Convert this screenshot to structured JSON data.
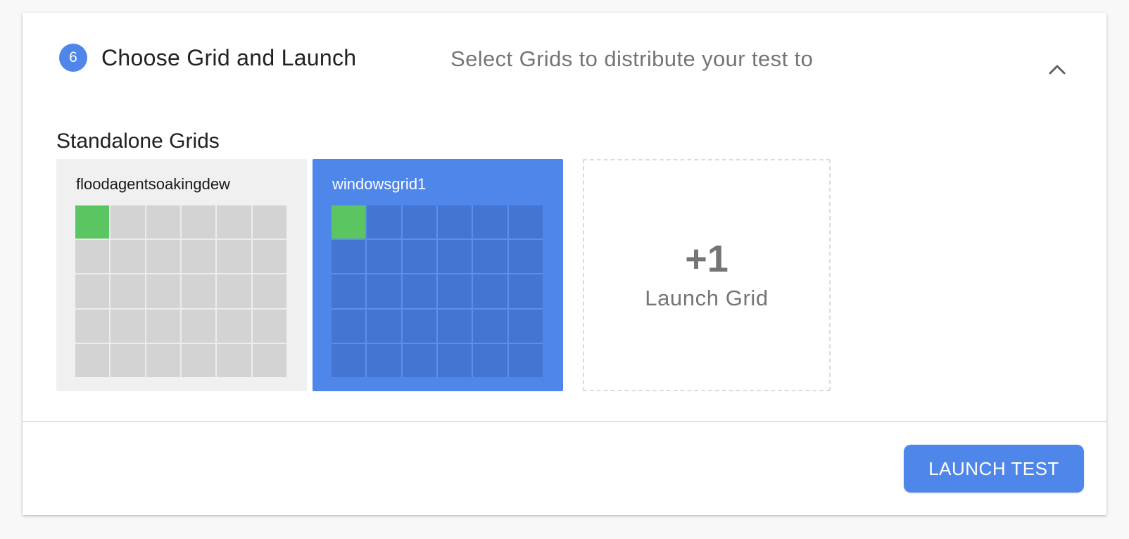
{
  "step": {
    "number": "6",
    "title": "Choose Grid and Launch",
    "subtitle": "Select Grids to distribute your test to",
    "collapse_icon": "chevron-up-icon"
  },
  "section": {
    "title": "Standalone Grids"
  },
  "grids": [
    {
      "name": "floodagentsoakingdew",
      "selected": false,
      "cell_count": 30,
      "active_cells": 1
    },
    {
      "name": "windowsgrid1",
      "selected": true,
      "cell_count": 30,
      "active_cells": 1
    }
  ],
  "launch_grid": {
    "count": "+1",
    "label": "Launch Grid"
  },
  "footer": {
    "launch_button": "LAUNCH TEST"
  },
  "colors": {
    "accent": "#4f86ea",
    "active_cell": "#5bc562",
    "idle_cell_plain": "#d3d3d3",
    "idle_cell_selected": "#4475d3"
  }
}
